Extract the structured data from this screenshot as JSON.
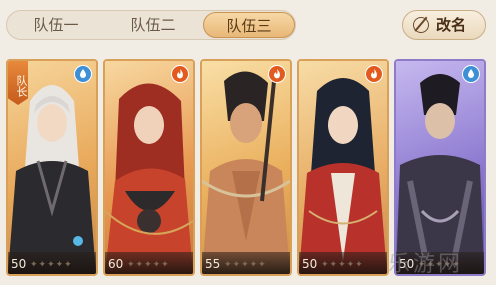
{
  "tabs": [
    {
      "label": "队伍一",
      "active": false
    },
    {
      "label": "队伍二",
      "active": false
    },
    {
      "label": "队伍三",
      "active": true
    }
  ],
  "rename": {
    "label": "改名",
    "icon": "pen-circle-icon"
  },
  "captain_label": "队长",
  "cards": [
    {
      "level": "50",
      "element": "water",
      "stars": "✦✦✦✦✦",
      "frame": "gold",
      "captain": true
    },
    {
      "level": "60",
      "element": "fire",
      "stars": "✦✦✦✦✦",
      "frame": "gold",
      "captain": false
    },
    {
      "level": "55",
      "element": "fire",
      "stars": "✦✦✦✦✦",
      "frame": "gold",
      "captain": false
    },
    {
      "level": "50",
      "element": "fire",
      "stars": "✦✦✦✦✦",
      "frame": "gold",
      "captain": false
    },
    {
      "level": "50",
      "element": "water",
      "stars": "✦✦✦✦✦",
      "frame": "purple",
      "captain": false
    }
  ],
  "watermark": "乐游网",
  "colors": {
    "accent": "#e8b778",
    "fire": "#e25a1e",
    "water": "#3d8fd6",
    "purple_frame": "#8e7cc9"
  }
}
